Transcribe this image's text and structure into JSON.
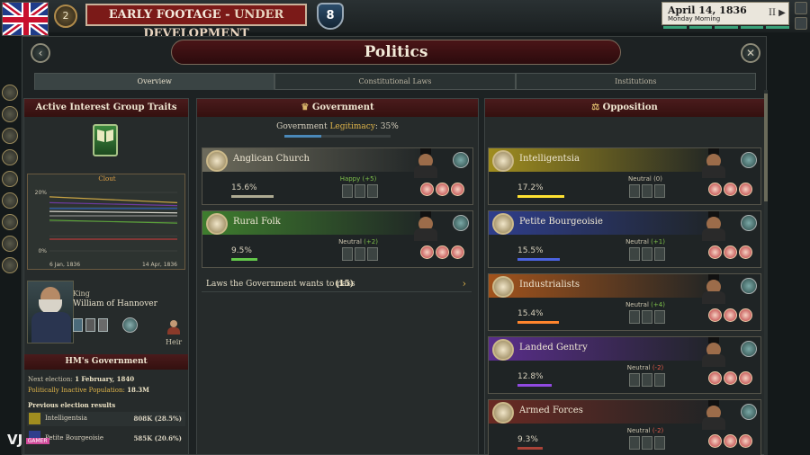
{
  "topbar": {
    "rank": "2",
    "banner_part1": "EARLY FOOTAGE",
    "banner_sep": " - ",
    "banner_part2": "UNDER DEVELOPMENT",
    "notifications": "8",
    "date": "April 14, 1836",
    "time_of_day": "Monday Morning",
    "time_controls": "II ▶"
  },
  "window": {
    "title": "Politics"
  },
  "tabs": [
    "Overview",
    "Constitutional Laws",
    "Institutions"
  ],
  "left": {
    "traits_title": "Active Interest Group Traits",
    "chart_title": "Clout",
    "hos_title": "King",
    "hos_name": "William of Hannover",
    "heir_label": "Heir",
    "gov_title": "HM's Government",
    "next_election_label": "Next election:",
    "next_election_value": "1 February, 1840",
    "inactive_label": "Politically Inactive Population:",
    "inactive_value": "18.3M",
    "prev_results_label": "Previous election results",
    "results": [
      {
        "name": "Intelligentsia",
        "value": "808K (28.5%)"
      },
      {
        "name": "Petite Bourgeoisie",
        "value": "585K (20.6%)"
      }
    ]
  },
  "chart_data": {
    "type": "line",
    "title": "Clout",
    "x_tick_labels": [
      "6 Jan, 1836",
      "14 Apr, 1836"
    ],
    "y_tick_labels": [
      "20%",
      "0%"
    ],
    "ylim": [
      0,
      20
    ],
    "grid": true,
    "x": [
      "6 Jan, 1836",
      "14 Apr, 1836"
    ],
    "series": [
      {
        "color": "#c9a443",
        "values": [
          18.5,
          16.5
        ]
      },
      {
        "color": "#6e3aa0",
        "values": [
          16.5,
          15.5
        ]
      },
      {
        "color": "#2e62b8",
        "values": [
          14.5,
          14.5
        ]
      },
      {
        "color": "#d8d6cc",
        "values": [
          13.5,
          13.0
        ]
      },
      {
        "color": "#8a8a8a",
        "values": [
          12.0,
          12.0
        ]
      },
      {
        "color": "#5aa03a",
        "values": [
          10.5,
          9.5
        ]
      },
      {
        "color": "#b73a3a",
        "values": [
          4.0,
          4.0
        ]
      }
    ]
  },
  "government": {
    "title": "Government",
    "legitimacy_label": "Government",
    "legitimacy_word": "Legitimacy",
    "legitimacy_value": ": 35%",
    "legitimacy_fraction": 0.35,
    "laws_label": "Laws the Government wants to pass",
    "laws_count": "(15)",
    "groups": [
      {
        "name": "Anglican Church",
        "pct": "15.6%",
        "approval": "Happy",
        "approval_mod": "(+5)",
        "color": "#6d6b5c",
        "fill": 0.156
      },
      {
        "name": "Rural Folk",
        "pct": "9.5%",
        "approval": "Neutral",
        "approval_mod": "(+2)",
        "color": "#3e7d2e",
        "fill": 0.095
      }
    ]
  },
  "opposition": {
    "title": "Opposition",
    "groups": [
      {
        "name": "Intelligentsia",
        "pct": "17.2%",
        "approval": "Neutral",
        "approval_mod": "(0)",
        "color": "#a08d1f",
        "fill": 0.172
      },
      {
        "name": "Petite Bourgeoisie",
        "pct": "15.5%",
        "approval": "Neutral",
        "approval_mod": "(+1)",
        "color": "#2f3e8c",
        "fill": 0.155
      },
      {
        "name": "Industrialists",
        "pct": "15.4%",
        "approval": "Neutral",
        "approval_mod": "(+4)",
        "color": "#a2531c",
        "fill": 0.154
      },
      {
        "name": "Landed Gentry",
        "pct": "12.8%",
        "approval": "Neutral",
        "approval_mod": "(-2)",
        "color": "#5a2e8c",
        "fill": 0.128
      },
      {
        "name": "Armed Forces",
        "pct": "9.3%",
        "approval": "Neutral",
        "approval_mod": "(-2)",
        "color": "#6a2a23",
        "fill": 0.093
      }
    ]
  },
  "colors": {
    "accent_red": "#7b1a18",
    "legitimacy_gold": "#e0b54a",
    "happy_green": "#7ec04a",
    "positive_green": "#7ec04a",
    "negative_red": "#e05a4a"
  }
}
